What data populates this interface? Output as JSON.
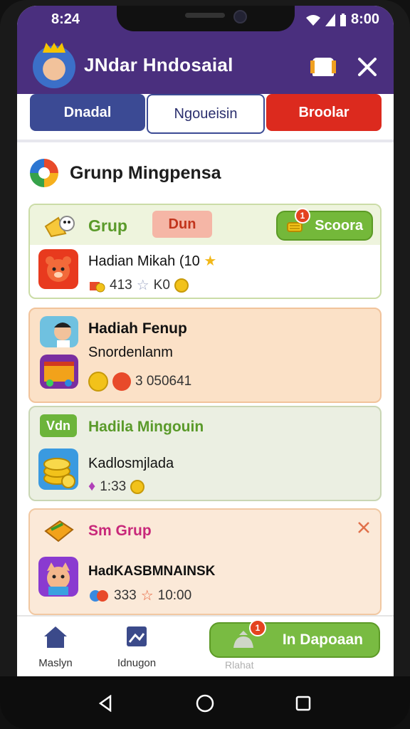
{
  "status_bar": {
    "time": "8:24",
    "time_right": "8:00"
  },
  "header": {
    "title": "JNdar Hndosaial"
  },
  "tabs": [
    {
      "label": "Dnadal"
    },
    {
      "label": "Ngoueisin"
    },
    {
      "label": "Broolar"
    }
  ],
  "section": {
    "title": "Grunp Mingpensa"
  },
  "cards": [
    {
      "title": "Grup",
      "tag": "Dun",
      "action": "Scoora",
      "action_badge": "1",
      "row_title": "Hadian Mikah (10",
      "meta_a": "413",
      "meta_b": "K0"
    },
    {
      "title": "Hadiah Fenup",
      "subtitle": "Snordenlanm",
      "meta": "3 050641"
    },
    {
      "tag": "Vdn",
      "title": "Hadila Mingouin",
      "subtitle": "Kadlosmjlada",
      "meta": "1:33"
    },
    {
      "title": "Sm Grup",
      "row_title": "HadKASBMNAINSK",
      "meta_a": "333",
      "meta_b": "10:00"
    }
  ],
  "bottom_nav": [
    {
      "label": "Maslyn"
    },
    {
      "label": "Idnugon"
    }
  ],
  "cta": {
    "label": "In Dapoaan",
    "badge": "1",
    "sub": "Rlahat"
  }
}
